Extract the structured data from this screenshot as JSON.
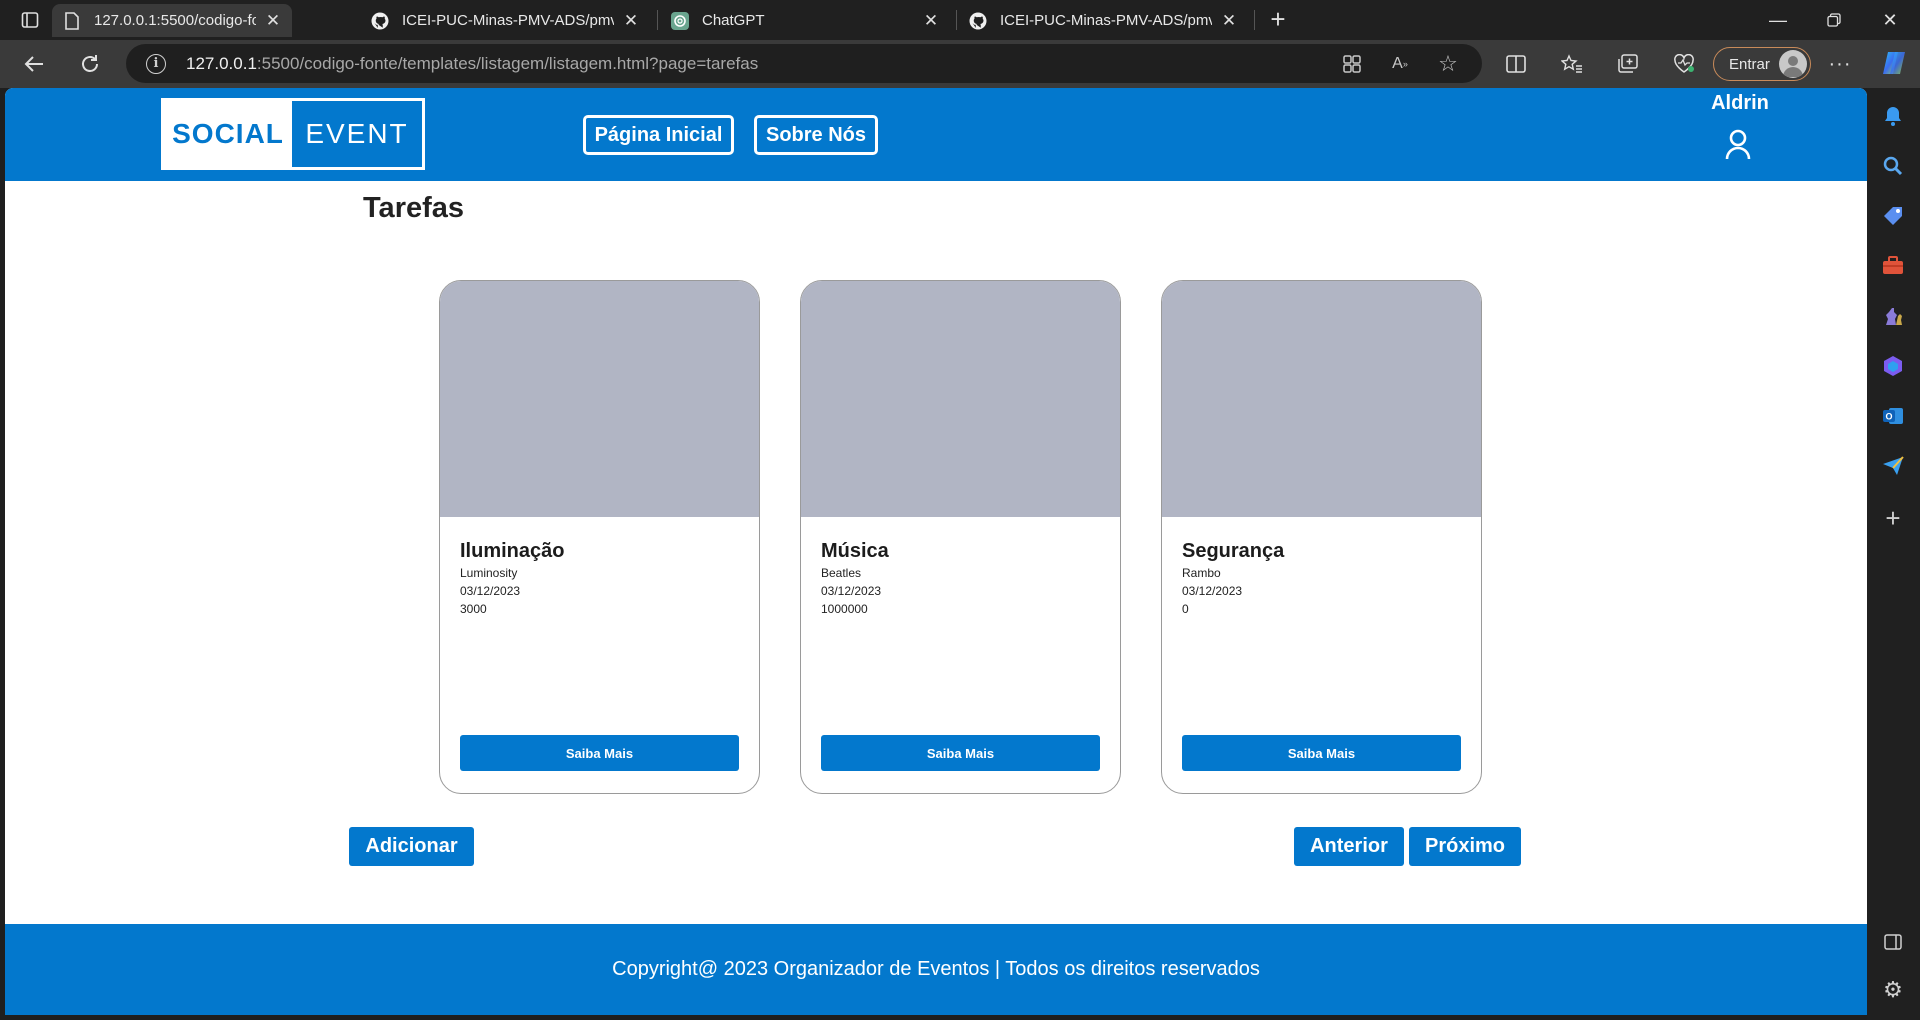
{
  "browser": {
    "tabs": [
      {
        "title": "127.0.0.1:5500/codigo-fonte/tem",
        "favicon": "page-icon"
      },
      {
        "title": "ICEI-PUC-Minas-PMV-ADS/pmv-",
        "favicon": "github-icon"
      },
      {
        "title": "ChatGPT",
        "favicon": "chatgpt-icon"
      },
      {
        "title": "ICEI-PUC-Minas-PMV-ADS/pmv-",
        "favicon": "github-icon"
      }
    ],
    "address": {
      "host": "127.0.0.1",
      "rest": ":5500/codigo-fonte/templates/listagem/listagem.html?page=tarefas"
    },
    "signin_label": "Entrar"
  },
  "site": {
    "logo_left": "SOCIAL",
    "logo_right": "EVENT",
    "nav": {
      "home": "Página Inicial",
      "about": "Sobre Nós"
    },
    "user_name": "Aldrin",
    "page_title": "Tarefas",
    "cards": [
      {
        "name": "Iluminação",
        "responsible": "Luminosity",
        "date": "03/12/2023",
        "value": "3000",
        "button": "Saiba Mais"
      },
      {
        "name": "Música",
        "responsible": "Beatles",
        "date": "03/12/2023",
        "value": "1000000",
        "button": "Saiba Mais"
      },
      {
        "name": "Segurança",
        "responsible": "Rambo",
        "date": "03/12/2023",
        "value": "0",
        "button": "Saiba Mais"
      }
    ],
    "actions": {
      "add": "Adicionar",
      "prev": "Anterior",
      "next": "Próximo"
    },
    "footer_text": "Copyright@ 2023 Organizador de Eventos | Todos os direitos reservados"
  },
  "colors": {
    "brand": "#0378cd",
    "card_image": "#b1b5c4"
  }
}
